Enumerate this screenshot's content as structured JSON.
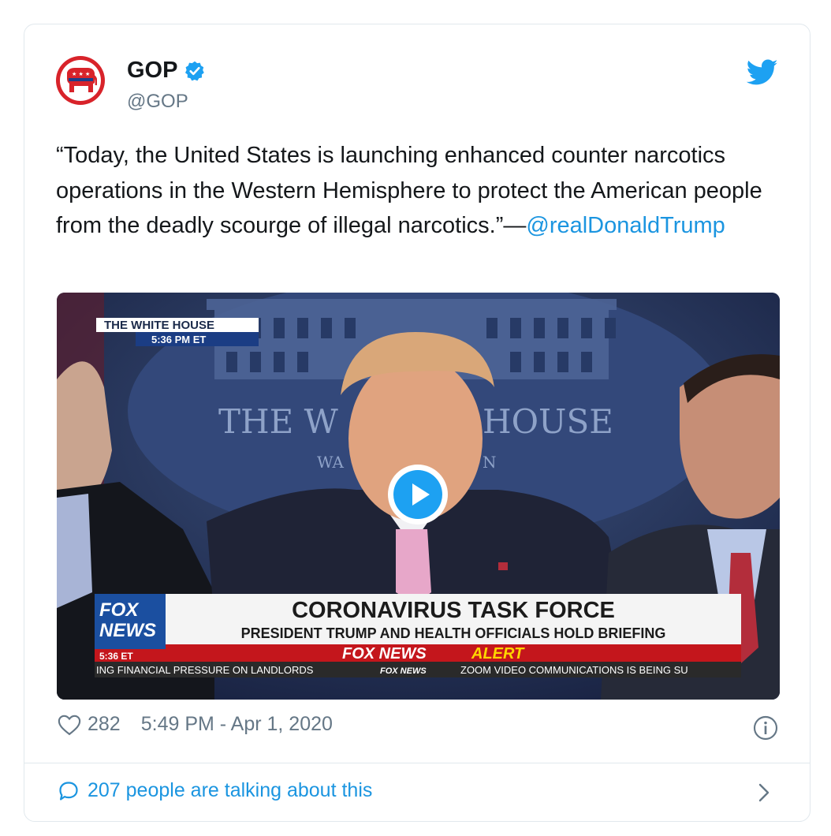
{
  "author": {
    "name": "GOP",
    "handle": "@GOP",
    "verified": true,
    "avatar_icon": "republican-elephant-logo",
    "brand_color": "#d8232a"
  },
  "tweet": {
    "text": "“Today, the United States is launching enhanced counter narcotics operations in the Western Hemisphere to protect the American people from the deadly scourge of illegal narcotics.”—",
    "mention": "@realDonaldTrump"
  },
  "media": {
    "type": "video",
    "overlay": {
      "location_label": "THE WHITE HOUSE",
      "location_time": "5:36 PM ET",
      "backdrop_text_1": "THE W",
      "backdrop_text_2": "HOUSE",
      "backdrop_text_3": "WA",
      "backdrop_text_4": "N",
      "network_logo_1": "FOX",
      "network_logo_2": "NEWS",
      "network_time": "5:36 ET",
      "headline": "CORONAVIRUS TASK FORCE",
      "subheadline": "PRESIDENT TRUMP AND HEALTH OFFICIALS HOLD BRIEFING",
      "alert_prefix": "FOX NEWS",
      "alert_suffix": "ALERT",
      "ticker_left": "ING FINANCIAL PRESSURE ON LANDLORDS",
      "ticker_logo": "FOX NEWS",
      "ticker_right": "ZOOM VIDEO COMMUNICATIONS IS BEING SU"
    }
  },
  "meta": {
    "likes": "282",
    "timestamp": "5:49 PM - Apr 1, 2020"
  },
  "footer": {
    "talking": "207 people are talking about this"
  },
  "colors": {
    "twitter_blue": "#1da1f2",
    "link_blue": "#1b95e0",
    "muted_gray": "#657786",
    "fox_red": "#c4161c"
  }
}
